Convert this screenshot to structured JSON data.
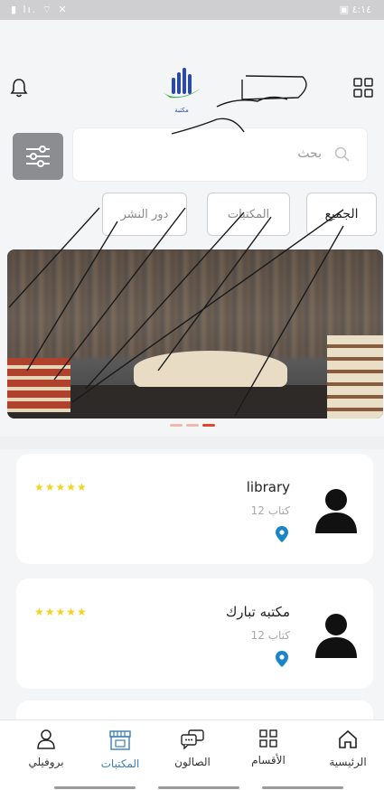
{
  "status_bar": {
    "left": "▮ lı. ⌔ ✕",
    "right": "▣ ٤:١٤"
  },
  "header": {
    "logo_text": "مكتبة",
    "search": {
      "placeholder": "بحث"
    }
  },
  "chips": {
    "all": "الجميع",
    "libraries": "المكتبات",
    "publishers": "دور النشر"
  },
  "carousel": {
    "dots": 3,
    "active": 3
  },
  "libraries": [
    {
      "name": "library",
      "book_count": "12 كتاب",
      "stars": "★★★★★"
    },
    {
      "name": "مكتبه تبارك",
      "book_count": "12 كتاب",
      "stars": "★★★★★"
    }
  ],
  "bottom_nav": {
    "home": "الرئيسية",
    "sections": "الأقسام",
    "salon": "الصالون",
    "libraries": "المكتبات",
    "profile": "بروفيلي"
  },
  "colors": {
    "accent": "#3a7fb3",
    "star": "#f3d323",
    "pin": "#1a86c8",
    "active_dot": "#e0462f"
  }
}
